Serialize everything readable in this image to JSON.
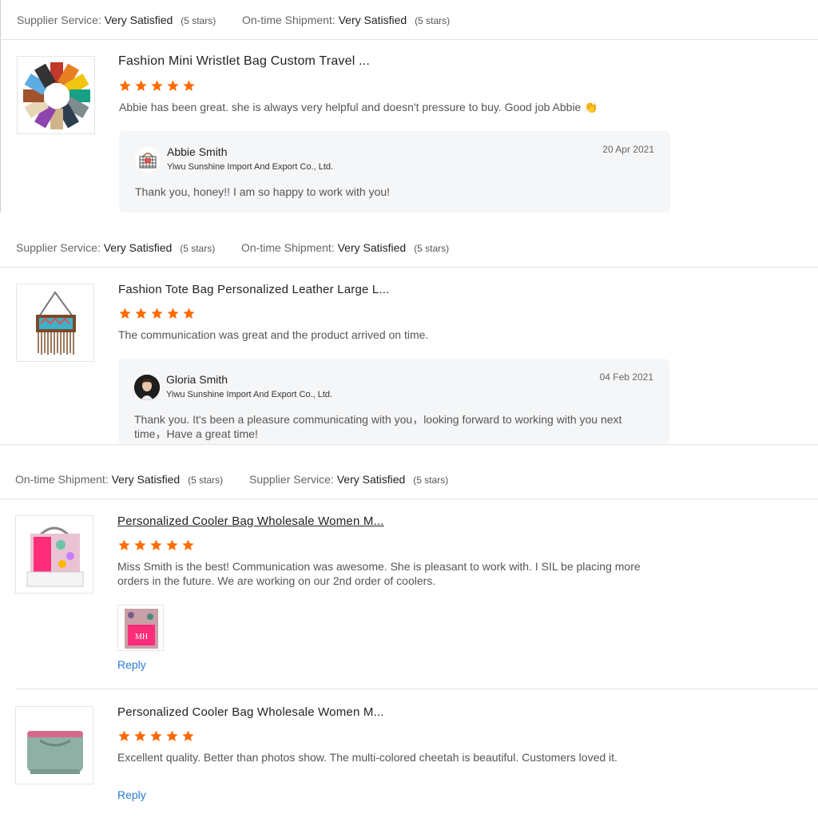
{
  "rating_levels": {
    "very_satisfied": "Very Satisfied",
    "five_stars": "(5 stars)"
  },
  "labels": {
    "supplier_service": "Supplier Service:",
    "ontime_shipment": "On-time Shipment:"
  },
  "colors": {
    "star": "#ff6a00",
    "link": "#2b7bd1",
    "reply_bg": "#f5f6f8",
    "divider": "#e2e2e2"
  },
  "reviews": [
    {
      "title": "Fashion Mini Wristlet Bag Custom Travel ...",
      "stars": 5,
      "text": "Abbie has been great.  she is always very helpful and doesn't pressure to buy.  Good job Abbie",
      "emoji": "👏",
      "reply": {
        "name": "Abbie Smith",
        "company": "Yiwu Sunshine Import And Export Co., Ltd.",
        "date": "20 Apr 2021",
        "message": "Thank you, honey!!  I am so happy to work with you!"
      }
    },
    {
      "title": "Fashion Tote Bag Personalized Leather Large L...",
      "stars": 5,
      "text": "The communication was great and the product arrived on time.",
      "reply": {
        "name": "Gloria Smith",
        "company": "Yiwu Sunshine Import And Export Co., Ltd.",
        "date": "04 Feb 2021",
        "message": "Thank you. It's been a pleasure communicating with you，looking forward to working with you next time，Have a great time!"
      }
    },
    {
      "title": "Personalized Cooler Bag Wholesale Women M...",
      "stars": 5,
      "text": "Miss Smith is the best! Communication was awesome.  She is pleasant to work with.  I SIL be placing more orders in the future.  We are working on our 2nd order of coolers.",
      "reply_link": "Reply"
    },
    {
      "title": "Personalized Cooler Bag Wholesale Women M...",
      "stars": 5,
      "text": "Excellent quality.   Better than photos show.  The multi-colored cheetah is beautiful.  Customers loved it.",
      "reply_link": "Reply"
    }
  ]
}
